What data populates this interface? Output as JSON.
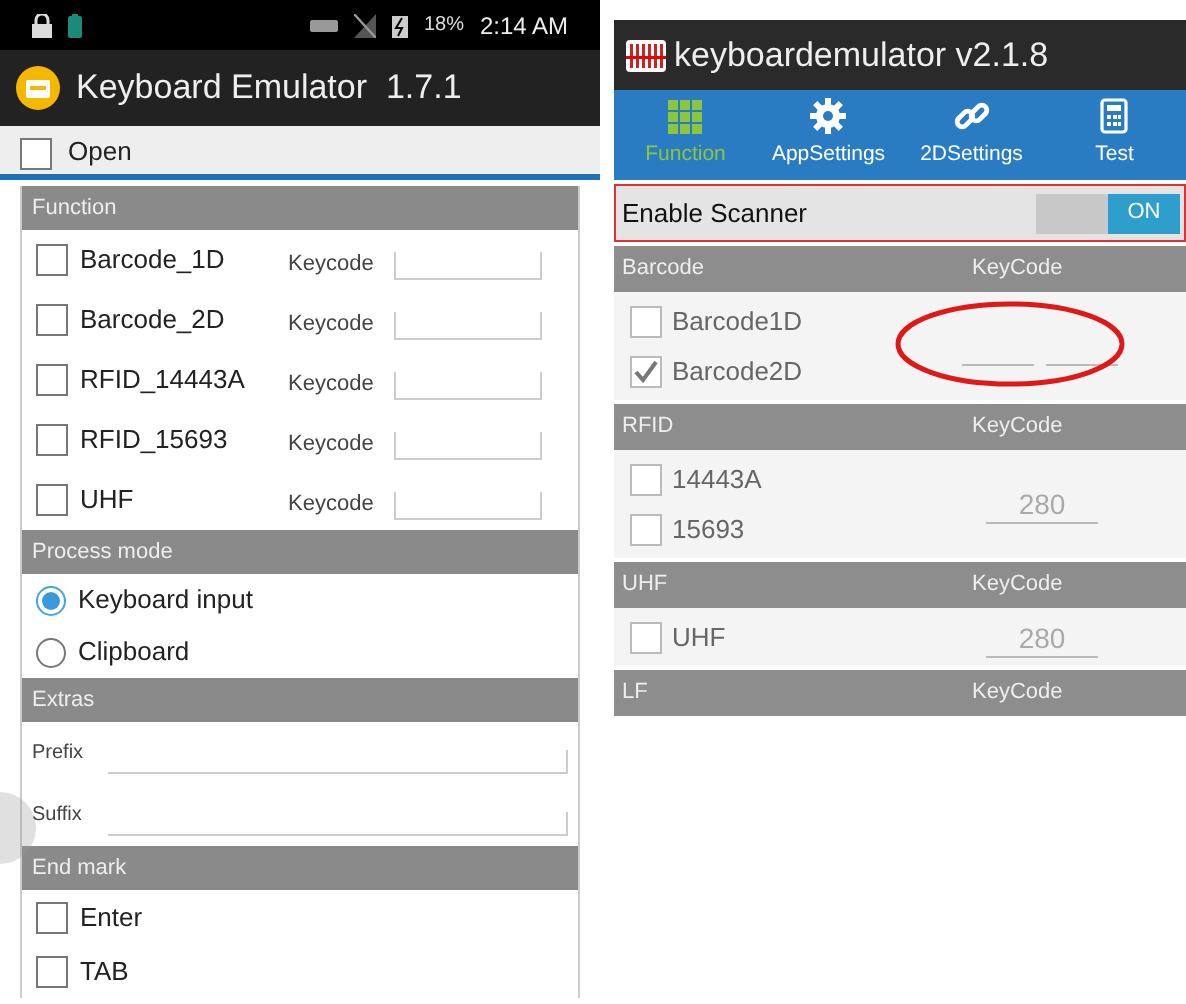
{
  "left_phone": {
    "status_bar": {
      "battery_percent": "18%",
      "time": "2:14 AM"
    },
    "app_bar": {
      "title": "Keyboard Emulator  1.7.1"
    },
    "open": {
      "label": "Open",
      "checked": false
    },
    "sections": [
      {
        "kind": "checks",
        "header": "Function",
        "items": [
          {
            "label": "Barcode_1D",
            "checked": false,
            "field_label": "Keycode"
          },
          {
            "label": "Barcode_2D",
            "checked": false,
            "field_label": "Keycode"
          },
          {
            "label": "RFID_14443A",
            "checked": false,
            "field_label": "Keycode"
          },
          {
            "label": "RFID_15693",
            "checked": false,
            "field_label": "Keycode"
          },
          {
            "label": "UHF",
            "checked": false,
            "field_label": "Keycode"
          }
        ]
      },
      {
        "kind": "radios",
        "header": "Process mode",
        "items": [
          {
            "label": "Keyboard input",
            "selected": true
          },
          {
            "label": "Clipboard",
            "selected": false
          }
        ]
      },
      {
        "kind": "fields",
        "header": "Extras",
        "items": [
          {
            "label": "Prefix"
          },
          {
            "label": "Suffix"
          }
        ]
      },
      {
        "kind": "checks",
        "header": "End mark",
        "items": [
          {
            "label": "Enter",
            "checked": false
          },
          {
            "label": "TAB",
            "checked": false
          }
        ]
      }
    ]
  },
  "right_phone": {
    "app_bar": {
      "title": "keyboardemulator v2.1.8"
    },
    "tabs": [
      {
        "label": "Function",
        "selected": true
      },
      {
        "label": "AppSettings",
        "selected": false
      },
      {
        "label": "2DSettings",
        "selected": false
      },
      {
        "label": "Test",
        "selected": false
      }
    ],
    "enable_scanner": {
      "label": "Enable Scanner",
      "switch_text": "ON",
      "on": true
    },
    "groups": [
      {
        "header": "Barcode",
        "column_header": "KeyCode",
        "items": [
          {
            "label": "Barcode1D",
            "checked": false
          },
          {
            "label": "Barcode2D",
            "checked": true
          }
        ],
        "fields": [
          {
            "kind": "input"
          },
          {
            "kind": "input"
          }
        ],
        "circled": true
      },
      {
        "header": "RFID",
        "column_header": "KeyCode",
        "items": [
          {
            "label": "14443A",
            "checked": false
          },
          {
            "label": "15693",
            "checked": false
          }
        ],
        "fields": [
          {
            "kind": "input",
            "value": "280"
          }
        ]
      },
      {
        "header": "UHF",
        "column_header": "KeyCode",
        "items": [
          {
            "label": "UHF",
            "checked": false
          }
        ],
        "fields": [
          {
            "kind": "input",
            "value": "280"
          }
        ]
      },
      {
        "header": "LF",
        "column_header": "KeyCode"
      }
    ]
  }
}
